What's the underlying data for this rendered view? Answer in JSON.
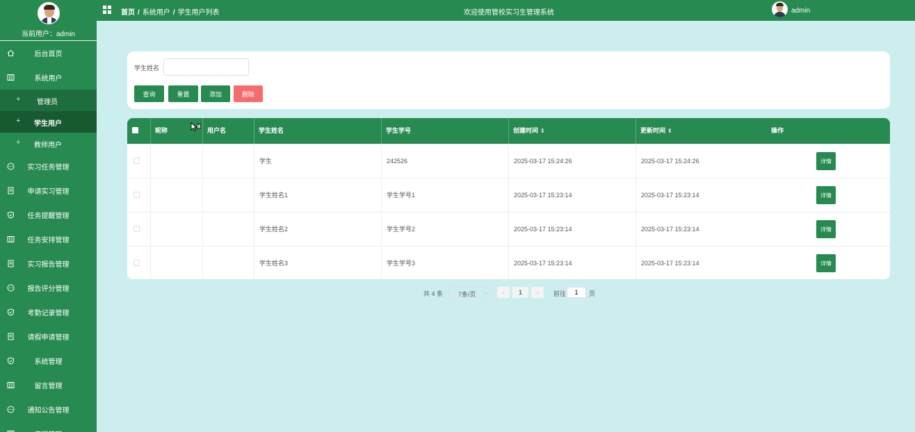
{
  "sidebar": {
    "current_user": "当前用户：admin",
    "items": [
      {
        "label": "后台首页",
        "icon": "home-icon"
      },
      {
        "label": "系统用户",
        "icon": "columns-icon"
      }
    ],
    "sub_items": [
      {
        "label": "管理员"
      },
      {
        "label": "学生用户"
      },
      {
        "label": "教师用户"
      }
    ],
    "more_items": [
      {
        "label": "实习任务管理",
        "icon": "chat-icon"
      },
      {
        "label": "申请实习管理",
        "icon": "document-icon"
      },
      {
        "label": "任务提醒管理",
        "icon": "shield-icon"
      },
      {
        "label": "任务安排管理",
        "icon": "columns-icon"
      },
      {
        "label": "实习报告管理",
        "icon": "document-icon"
      },
      {
        "label": "报告评分管理",
        "icon": "chat-icon"
      },
      {
        "label": "考勤记录管理",
        "icon": "shield-icon"
      },
      {
        "label": "请假申请管理",
        "icon": "document-icon"
      },
      {
        "label": "系统管理",
        "icon": "shield-icon"
      },
      {
        "label": "留言管理",
        "icon": "columns-icon"
      },
      {
        "label": "通知公告管理",
        "icon": "chat-icon"
      },
      {
        "label": "资源管理",
        "icon": "columns-icon"
      }
    ]
  },
  "header": {
    "breadcrumb": [
      "首页",
      "系统用户",
      "学生用户列表"
    ],
    "welcome": "欢迎使用管校实习生管理系统",
    "username": "admin"
  },
  "search": {
    "label": "学生姓名",
    "value": "",
    "placeholder": "",
    "buttons": {
      "query": "查询",
      "reset": "重置",
      "add": "添加",
      "delete": "删除"
    }
  },
  "table": {
    "headers": [
      "昵称",
      "用户名",
      "学生姓名",
      "学生学号",
      "创建时间",
      "更新时间",
      "操作"
    ],
    "sort_glyph": "⇕",
    "rows": [
      {
        "nickname": "",
        "username": "",
        "name": "学生",
        "number": "242526",
        "created": "2025-03-17 15:24:26",
        "updated": "2025-03-17 15:24:26",
        "action": "详情"
      },
      {
        "nickname": "",
        "username": "",
        "name": "学生姓名1",
        "number": "学生学号1",
        "created": "2025-03-17 15:23:14",
        "updated": "2025-03-17 15:23:14",
        "action": "详情"
      },
      {
        "nickname": "",
        "username": "",
        "name": "学生姓名2",
        "number": "学生学号2",
        "created": "2025-03-17 15:23:14",
        "updated": "2025-03-17 15:23:14",
        "action": "详情"
      },
      {
        "nickname": "",
        "username": "",
        "name": "学生姓名3",
        "number": "学生学号3",
        "created": "2025-03-17 15:23:14",
        "updated": "2025-03-17 15:23:14",
        "action": "详情"
      }
    ]
  },
  "pagination": {
    "total": "共 4 条",
    "page_size": "7条/页",
    "current_page": "1",
    "goto_label": "前往",
    "goto_value": "1",
    "page_suffix": "页"
  },
  "colors": {
    "primary": "#278a50",
    "danger": "#f56c6c",
    "background": "#cdeeee"
  }
}
